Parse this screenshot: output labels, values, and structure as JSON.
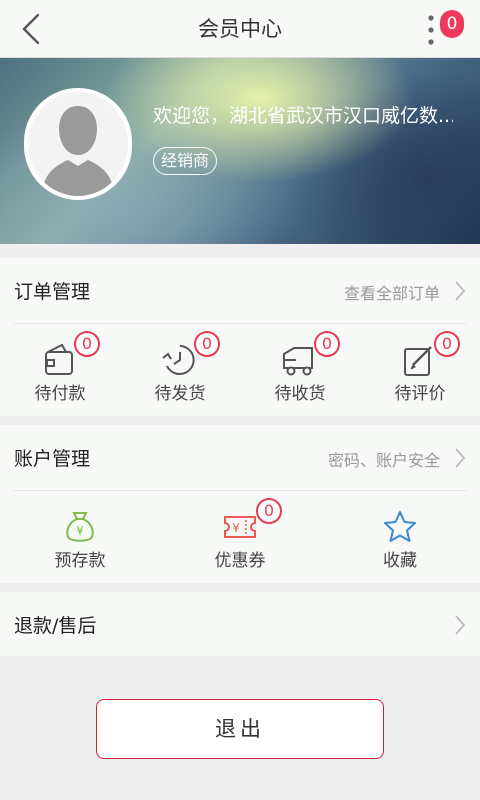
{
  "header": {
    "title": "会员中心",
    "menu_badge": "0"
  },
  "profile": {
    "welcome_text": "欢迎您，湖北省武汉市汉口威亿数...",
    "role": "经销商"
  },
  "orders": {
    "title": "订单管理",
    "link": "查看全部订单",
    "items": [
      {
        "label": "待付款",
        "badge": "0",
        "icon": "wallet-icon"
      },
      {
        "label": "待发货",
        "badge": "0",
        "icon": "clock-send-icon"
      },
      {
        "label": "待收货",
        "badge": "0",
        "icon": "truck-icon"
      },
      {
        "label": "待评价",
        "badge": "0",
        "icon": "edit-review-icon"
      }
    ]
  },
  "account": {
    "title": "账户管理",
    "link": "密码、账户安全",
    "items": [
      {
        "label": "预存款",
        "icon": "money-bag-icon"
      },
      {
        "label": "优惠券",
        "badge": "0",
        "icon": "coupon-icon"
      },
      {
        "label": "收藏",
        "icon": "star-icon"
      }
    ]
  },
  "refund": {
    "title": "退款/售后"
  },
  "logout_label": "退出",
  "colors": {
    "accent_red": "#e83b54",
    "coupon_red": "#e85a52",
    "money_green": "#7dbd4e",
    "star_blue": "#3f86d8"
  }
}
